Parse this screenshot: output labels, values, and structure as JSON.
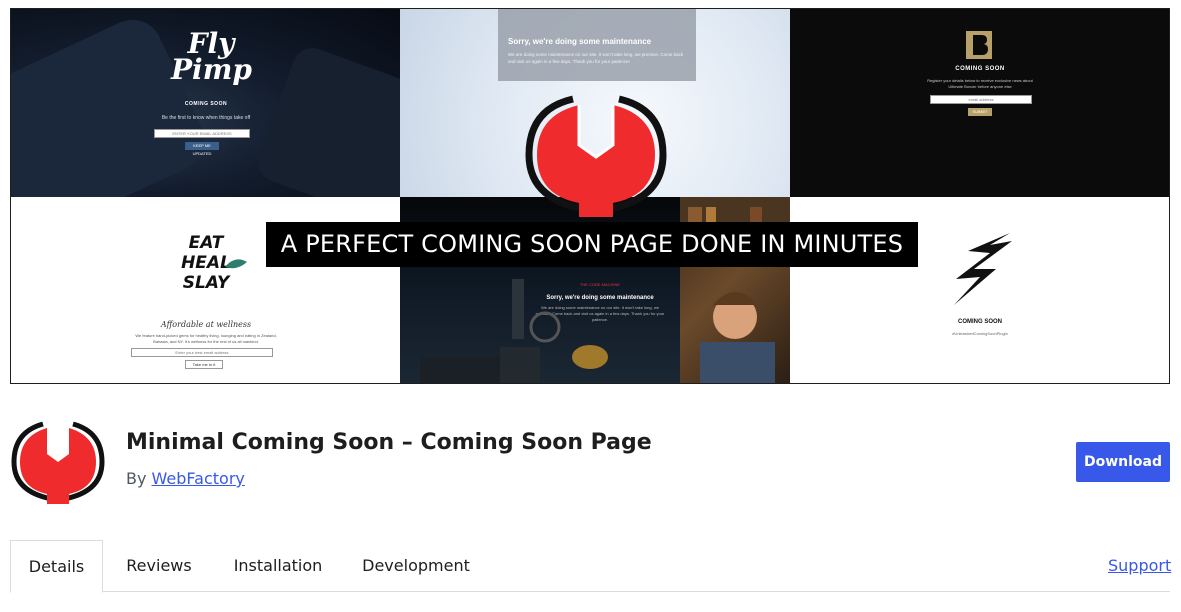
{
  "banner": {
    "headline": "A PERFECT COMING SOON PAGE DONE IN MINUTES",
    "tiles": {
      "fly_pimp": {
        "brand": "Fly Pimp",
        "coming_soon": "COMING SOON",
        "tagline": "Be the first to know when things take off",
        "input_placeholder": "ENTER YOUR EMAIL ADDRESS",
        "button": "KEEP ME UPDATED"
      },
      "maintenance_water": {
        "title": "Sorry, we're doing some maintenance",
        "text": "We are doing some maintenance on our site. It won't take long, we promise. Come back and visit us again in a few days. Thank you for your patience!"
      },
      "b_logo": {
        "coming_soon": "COMING SOON",
        "text": "Register your details below to receive exclusive news about Ultimate Boxxer before anyone else",
        "input_placeholder": "email address",
        "button": "SUBMIT"
      },
      "eat_heal_slay": {
        "brand_line1": "EAT HEAL",
        "brand_line2": "SLAY",
        "subtitle": "Affordable at wellness",
        "text": "We feature hand-picked gems for healthy living, lounging and eating in Zealand, Bahasia, and NY. It's wellness for the rest of us all mankind.",
        "input_placeholder": "Enter your best email address",
        "button": "Take me to it"
      },
      "maintenance_dark": {
        "brand": "THE CODE MACHINE",
        "title": "Sorry, we're doing some maintenance",
        "text": "We are doing some maintenance on our site. It won't take long, we promise. Come back and visit us again in a few days. Thank you for your patience."
      },
      "lightning": {
        "coming_soon": "COMING SOON",
        "hashtag": "#UnleashedComingSoonPlugin"
      }
    }
  },
  "plugin": {
    "title": "Minimal Coming Soon – Coming Soon Page",
    "by_label": "By",
    "author": "WebFactory",
    "download_label": "Download"
  },
  "tabs": [
    {
      "label": "Details",
      "active": true
    },
    {
      "label": "Reviews",
      "active": false
    },
    {
      "label": "Installation",
      "active": false
    },
    {
      "label": "Development",
      "active": false
    }
  ],
  "support_label": "Support",
  "colors": {
    "accent": "#3858e9",
    "logo_red": "#ef2b2d",
    "logo_black": "#111111"
  }
}
